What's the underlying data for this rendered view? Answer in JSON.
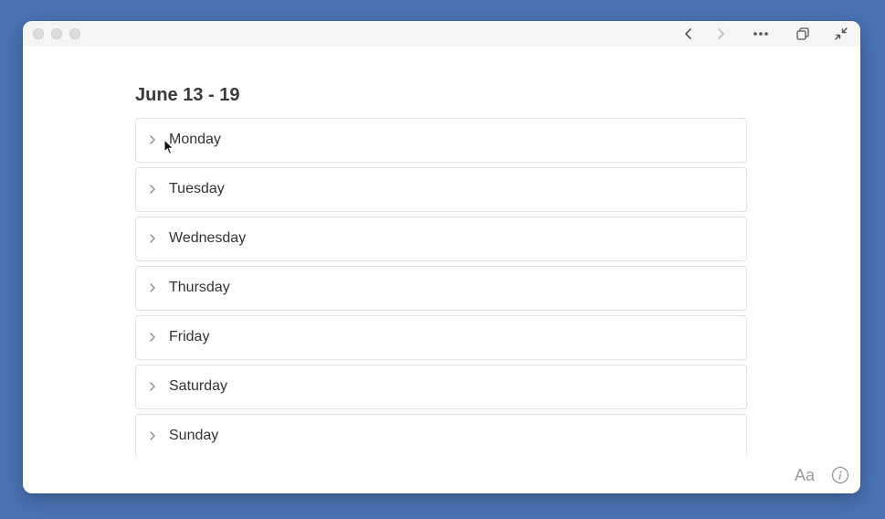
{
  "page": {
    "title": "June 13 - 19"
  },
  "days": [
    {
      "label": "Monday"
    },
    {
      "label": "Tuesday"
    },
    {
      "label": "Wednesday"
    },
    {
      "label": "Thursday"
    },
    {
      "label": "Friday"
    },
    {
      "label": "Saturday"
    },
    {
      "label": "Sunday"
    }
  ],
  "footer": {
    "format_label": "Aa"
  },
  "icons": {
    "back": "chevron-left-icon",
    "forward": "chevron-right-icon",
    "more": "more-dots-icon",
    "duplicate": "duplicate-window-icon",
    "collapse": "collapse-arrows-icon",
    "info": "info-icon",
    "row": "chevron-right-icon"
  },
  "colors": {
    "desktop": "#4a73b4",
    "window": "#ffffff",
    "row_border": "#e2e2e2",
    "text": "#333333"
  }
}
